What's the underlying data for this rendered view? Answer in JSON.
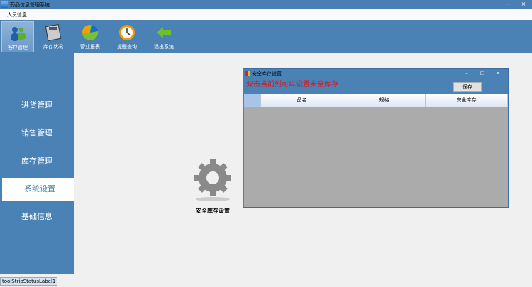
{
  "window": {
    "title": "药品信息管理系统",
    "minimize": "–",
    "close": "×"
  },
  "menu": {
    "items": [
      "人员信息"
    ]
  },
  "toolbar": {
    "items": [
      "客户管理",
      "库存状况",
      "营业报表",
      "提醒查询",
      "退出系统"
    ]
  },
  "sidebar": {
    "items": [
      "进货管理",
      "销售管理",
      "库存管理",
      "系统设置",
      "基础信息"
    ],
    "active": "系统设置"
  },
  "main": {
    "gear_label": "安全库存设置"
  },
  "dialog": {
    "title": "安全库存设置",
    "hint": "双击当前列可以设置安全库存",
    "save": "保存",
    "columns": [
      "品名",
      "规格",
      "安全库存"
    ],
    "min": "–",
    "max": "□",
    "close": "×"
  },
  "status": {
    "label": "toolStripStatusLabel1"
  }
}
